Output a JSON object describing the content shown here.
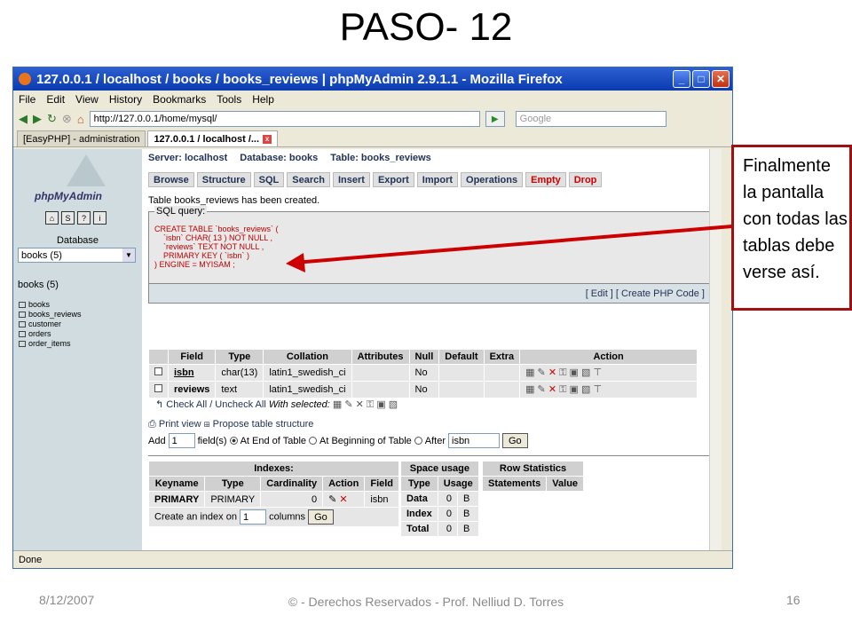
{
  "slide_title": "PASO- 12",
  "window": {
    "title": "127.0.0.1 / localhost / books / books_reviews | phpMyAdmin 2.9.1.1 - Mozilla Firefox",
    "menu": [
      "File",
      "Edit",
      "View",
      "History",
      "Bookmarks",
      "Tools",
      "Help"
    ],
    "url": "http://127.0.0.1/home/mysql/",
    "search_placeholder": "Google",
    "tabs": [
      "[EasyPHP] - administration",
      "127.0.0.1 / localhost /..."
    ],
    "status": "Done"
  },
  "sidebar": {
    "logo": "phpMyAdmin",
    "database_label": "Database",
    "selected_db": "books (5)",
    "db_heading": "books (5)",
    "tables": [
      "books",
      "books_reviews",
      "customer",
      "orders",
      "order_items"
    ]
  },
  "breadcrumb": [
    "Server: localhost",
    "Database: books",
    "Table: books_reviews"
  ],
  "page_tabs": [
    "Browse",
    "Structure",
    "SQL",
    "Search",
    "Insert",
    "Export",
    "Import",
    "Operations",
    "Empty",
    "Drop"
  ],
  "created_msg": "Table books_reviews has been created.",
  "sql": {
    "legend": "SQL query:",
    "lines": [
      "CREATE TABLE `books_reviews` (",
      "`isbn` CHAR( 13 ) NOT NULL ,",
      "`reviews` TEXT NOT NULL ,",
      "PRIMARY KEY ( `isbn` )",
      ") ENGINE = MYISAM ;"
    ],
    "links": "[ Edit ] [ Create PHP Code ]"
  },
  "fields": {
    "headers": [
      "Field",
      "Type",
      "Collation",
      "Attributes",
      "Null",
      "Default",
      "Extra",
      "Action"
    ],
    "rows": [
      [
        "isbn",
        "char(13)",
        "latin1_swedish_ci",
        "",
        "No",
        "",
        ""
      ],
      [
        "reviews",
        "text",
        "latin1_swedish_ci",
        "",
        "No",
        "",
        ""
      ]
    ],
    "check_all": "Check All / Uncheck All",
    "with_selected": "With selected:"
  },
  "print_view": "Print view",
  "propose": "Propose table structure",
  "add_row": {
    "add": "Add",
    "count": "1",
    "fields": "field(s)",
    "end": "At End of Table",
    "begin": "At Beginning of Table",
    "after": "After",
    "after_sel": "isbn",
    "go": "Go"
  },
  "indexes": {
    "title": "Indexes:",
    "headers": [
      "Keyname",
      "Type",
      "Cardinality",
      "Action",
      "Field"
    ],
    "row": [
      "PRIMARY",
      "PRIMARY",
      "0",
      "isbn"
    ],
    "create_label": "Create an index on",
    "create_val": "1",
    "columns": "columns",
    "go": "Go"
  },
  "space": {
    "title": "Space usage",
    "headers": [
      "Type",
      "Usage"
    ],
    "rows": [
      [
        "Data",
        "0",
        "B"
      ],
      [
        "Index",
        "0",
        "B"
      ],
      [
        "Total",
        "0",
        "B"
      ]
    ]
  },
  "rowstats": {
    "title": "Row Statistics",
    "headers": [
      "Statements",
      "Value"
    ]
  },
  "callout": "Finalmente la pantalla con todas las tablas debe verse así.",
  "footer": {
    "date": "8/12/2007",
    "credit": "© - Derechos Reservados  - Prof. Nelliud D. Torres",
    "page": "16"
  }
}
